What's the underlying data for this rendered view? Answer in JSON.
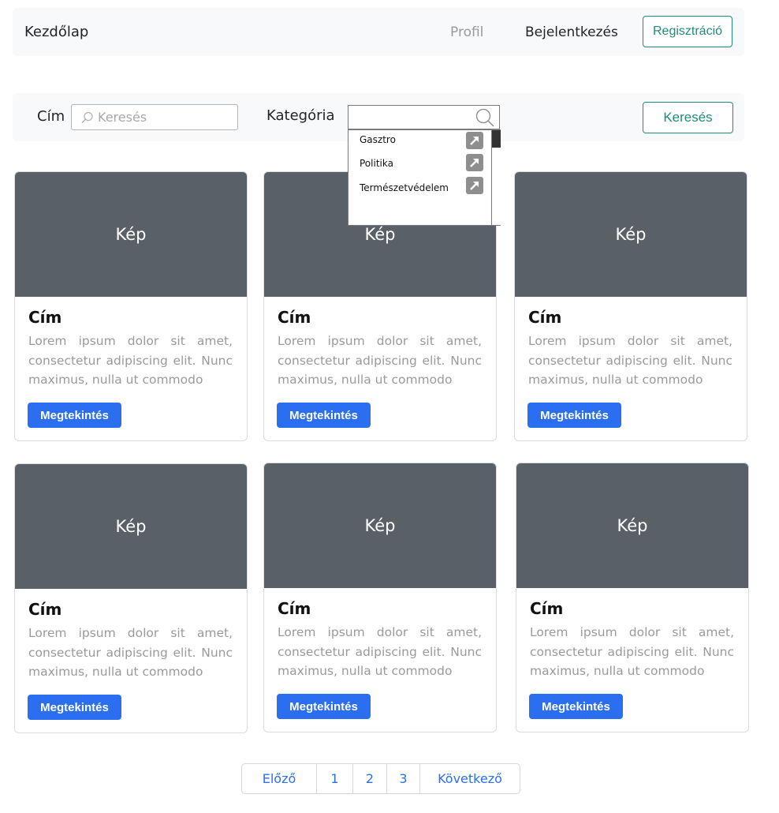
{
  "navbar": {
    "brand": "Kezdőlap",
    "profile": "Profil",
    "login": "Bejelentkezés",
    "register": "Regisztráció"
  },
  "search": {
    "title_label": "Cím",
    "placeholder": "Keresés",
    "category_label": "Kategória",
    "button": "Keresés"
  },
  "category_dropdown": {
    "options": [
      "Gasztro",
      "Politika",
      "Természetvédelem"
    ]
  },
  "cards": [
    {
      "image": "Kép",
      "title": "Cím",
      "text": "Lorem ipsum dolor sit amet, consectetur adipiscing elit. Nunc maximus, nulla ut commodo",
      "button": "Megtekintés"
    },
    {
      "image": "Kép",
      "title": "Cím",
      "text": "Lorem ipsum dolor sit amet, consectetur adipiscing elit. Nunc maximus, nulla ut commodo",
      "button": "Megtekintés"
    },
    {
      "image": "Kép",
      "title": "Cím",
      "text": "Lorem ipsum dolor sit amet, consectetur adipiscing elit. Nunc maximus, nulla ut commodo",
      "button": "Megtekintés"
    },
    {
      "image": "Kép",
      "title": "Cím",
      "text": "Lorem ipsum dolor sit amet, consectetur adipiscing elit. Nunc maximus, nulla ut commodo",
      "button": "Megtekintés"
    },
    {
      "image": "Kép",
      "title": "Cím",
      "text": "Lorem ipsum dolor sit amet, consectetur adipiscing elit. Nunc maximus, nulla ut commodo",
      "button": "Megtekintés"
    },
    {
      "image": "Kép",
      "title": "Cím",
      "text": "Lorem ipsum dolor sit amet, consectetur adipiscing elit. Nunc maximus, nulla ut commodo",
      "button": "Megtekintés"
    }
  ],
  "pagination": {
    "prev": "Előző",
    "pages": [
      "1",
      "2",
      "3"
    ],
    "next": "Következő"
  },
  "colors": {
    "accent_green": "#1e8c78",
    "button_blue": "#2b6ff0",
    "image_placeholder": "#5a6068"
  }
}
